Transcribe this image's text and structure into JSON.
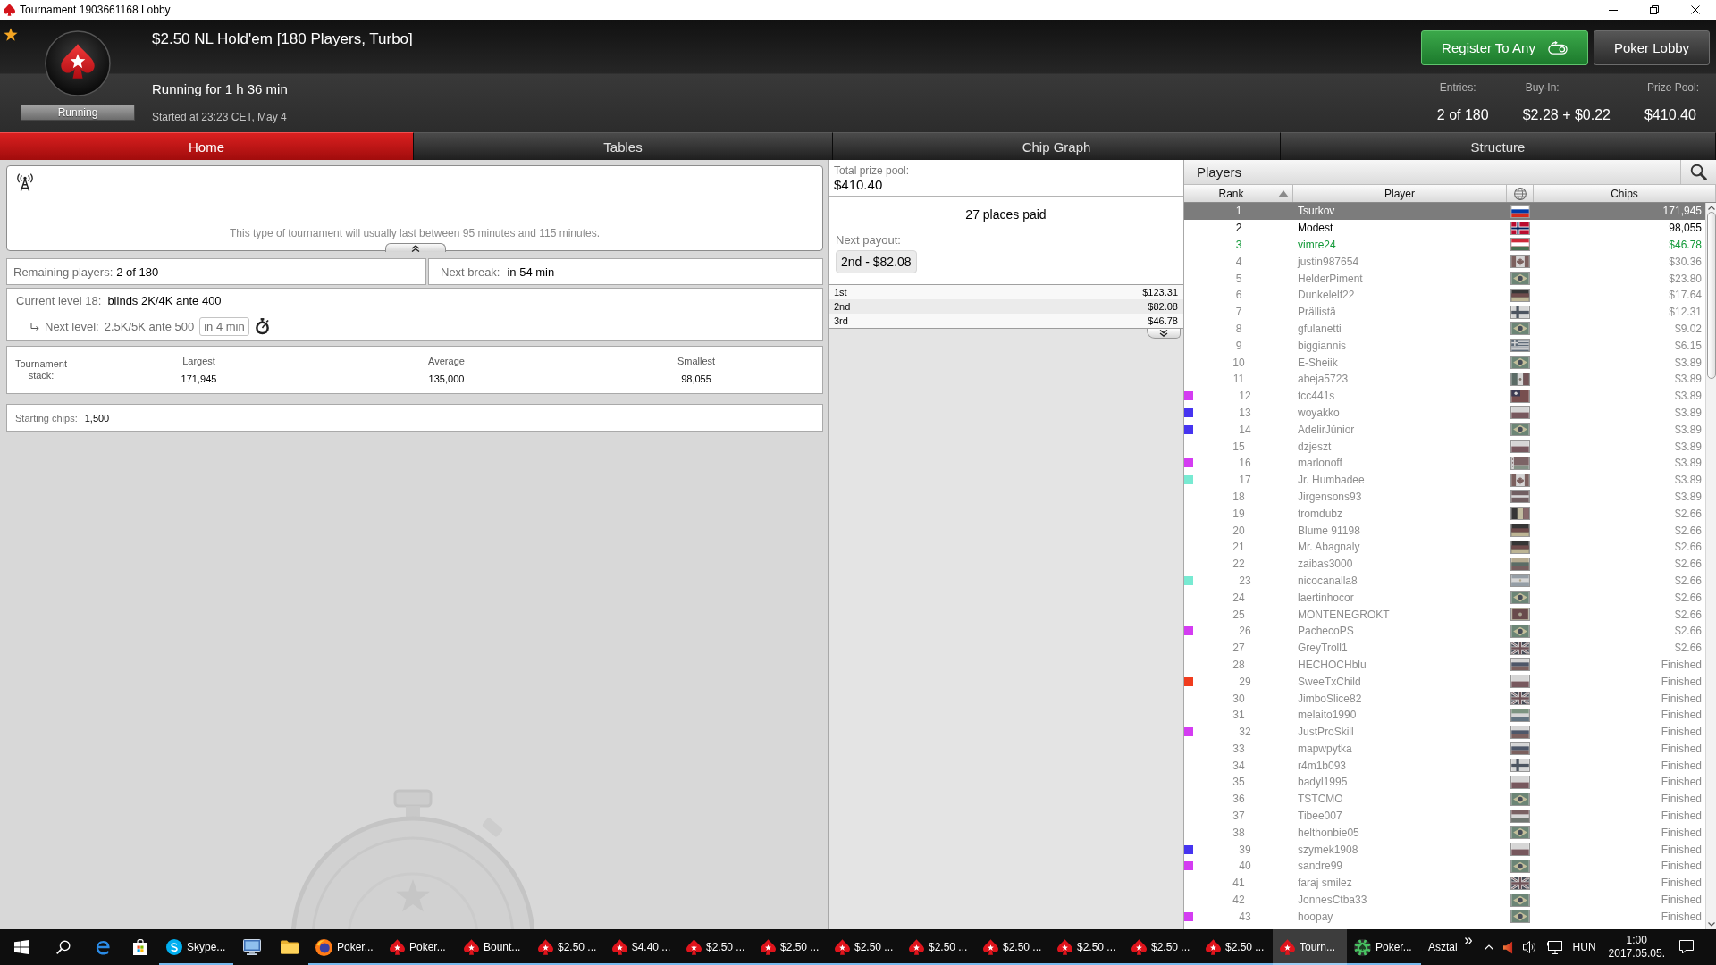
{
  "window": {
    "title": "Tournament 1903661168 Lobby"
  },
  "header": {
    "title": "$2.50 NL Hold'em [180 Players, Turbo]",
    "status": "Running",
    "running_for": "Running for 1 h 36 min",
    "started": "Started at 23:23 CET, May 4",
    "buttons": [
      {
        "label": "Register To Any",
        "kind": "primary"
      },
      {
        "label": "Poker Lobby",
        "kind": "secondary"
      }
    ],
    "stats": [
      {
        "label": "Entries:",
        "value": "2 of 180"
      },
      {
        "label": "Buy-In:",
        "value": "$2.28 + $0.22"
      },
      {
        "label": "Prize Pool:",
        "value": "$410.40"
      }
    ]
  },
  "tabs": [
    {
      "label": "Home",
      "selected": true
    },
    {
      "label": "Tables",
      "selected": false
    },
    {
      "label": "Chip Graph",
      "selected": false
    },
    {
      "label": "Structure",
      "selected": false
    }
  ],
  "info": {
    "note": "This type of tournament will usually last between 95 minutes and 115 minutes."
  },
  "summary": {
    "remaining": {
      "label": "Remaining players:",
      "value": "2 of 180"
    },
    "next_break": {
      "label": "Next break:",
      "value": "in 54 min"
    }
  },
  "level": {
    "current_label": "Current level 18:",
    "current": "blinds 2K/4K ante 400",
    "next_label": "Next level:",
    "next": "2.5K/5K ante 500",
    "next_in": "in 4 min"
  },
  "stack": {
    "label": "Tournament stack:",
    "columns": [
      {
        "label": "Largest",
        "value": "171,945"
      },
      {
        "label": "Average",
        "value": "135,000"
      },
      {
        "label": "Smallest",
        "value": "98,055"
      }
    ]
  },
  "starting_chips": {
    "label": "Starting chips:",
    "value": "1,500"
  },
  "prizes": {
    "total_label": "Total prize pool:",
    "total": "$410.40",
    "places_paid": "27 places paid",
    "next_payout_label": "Next payout:",
    "next_payout": "2nd - $82.08",
    "payouts": [
      {
        "place": "1st",
        "amount": "$123.31"
      },
      {
        "place": "2nd",
        "amount": "$82.08"
      },
      {
        "place": "3rd",
        "amount": "$46.78"
      }
    ]
  },
  "players": {
    "title": "Players",
    "columns": [
      {
        "kind": "text",
        "label": "Rank",
        "sorted": true
      },
      {
        "kind": "text",
        "label": "Player",
        "sorted": false
      },
      {
        "kind": "icon",
        "sorted": false
      },
      {
        "kind": "text",
        "label": "Chips",
        "sorted": false
      }
    ],
    "rows": [
      {
        "rank": "1",
        "player": "Tsurkov",
        "flag": {
          "kind": "russia"
        },
        "chips": "171,945",
        "kind": "playing",
        "selected": true
      },
      {
        "rank": "2",
        "player": "Modest",
        "flag": {
          "kind": "norway"
        },
        "chips": "98,055",
        "kind": "playing",
        "selected": false
      },
      {
        "rank": "3",
        "player": "vimre24",
        "flag": {
          "kind": "hungary"
        },
        "chips": "$46.78",
        "kind": "self",
        "selected": false
      },
      {
        "rank": "4",
        "player": "justin987654",
        "flag": {
          "kind": "canada"
        },
        "chips": "$30.36",
        "kind": "out",
        "selected": false
      },
      {
        "rank": "5",
        "player": "HelderPiment",
        "flag": {
          "kind": "brazil"
        },
        "chips": "$23.80",
        "kind": "out",
        "selected": false
      },
      {
        "rank": "6",
        "player": "Dunkelelf22",
        "flag": {
          "kind": "germany"
        },
        "chips": "$17.64",
        "kind": "out",
        "selected": false
      },
      {
        "rank": "7",
        "player": "Prällistä",
        "flag": {
          "kind": "finland"
        },
        "chips": "$12.31",
        "kind": "out",
        "selected": false
      },
      {
        "rank": "8",
        "player": "gfulanetti",
        "flag": {
          "kind": "brazil"
        },
        "chips": "$9.02",
        "kind": "out",
        "selected": false
      },
      {
        "rank": "9",
        "player": "biggiannis",
        "flag": {
          "kind": "greece"
        },
        "chips": "$6.15",
        "kind": "out",
        "selected": false
      },
      {
        "rank": "10",
        "player": "E-Sheiik",
        "flag": {
          "kind": "brazil"
        },
        "chips": "$3.89",
        "kind": "out",
        "selected": false
      },
      {
        "rank": "11",
        "player": "abeja5723",
        "flag": {
          "kind": "mexico"
        },
        "chips": "$3.89",
        "kind": "out",
        "selected": false
      },
      {
        "rank": "12",
        "player": "tcc441s",
        "flag": {
          "kind": "taiwan"
        },
        "chips": "$3.89",
        "kind": "out",
        "selected": false,
        "color": "#d43cf2"
      },
      {
        "rank": "13",
        "player": "woyakko",
        "flag": {
          "kind": "poland"
        },
        "chips": "$3.89",
        "kind": "out",
        "selected": false,
        "color": "#4634f0"
      },
      {
        "rank": "14",
        "player": "AdelirJúnior",
        "flag": {
          "kind": "brazil"
        },
        "chips": "$3.89",
        "kind": "out",
        "selected": false,
        "color": "#4634f0"
      },
      {
        "rank": "15",
        "player": "dzjeszt",
        "flag": {
          "kind": "poland"
        },
        "chips": "$3.89",
        "kind": "out",
        "selected": false
      },
      {
        "rank": "16",
        "player": "marlonoff",
        "flag": {
          "kind": "belarus"
        },
        "chips": "$3.89",
        "kind": "out",
        "selected": false,
        "color": "#d43cf2"
      },
      {
        "rank": "17",
        "player": "Jr. Humbadee",
        "flag": {
          "kind": "canada"
        },
        "chips": "$3.89",
        "kind": "out",
        "selected": false,
        "color": "#78ead2"
      },
      {
        "rank": "18",
        "player": "Jirgensons93",
        "flag": {
          "kind": "latvia"
        },
        "chips": "$3.89",
        "kind": "out",
        "selected": false
      },
      {
        "rank": "19",
        "player": "tromdubz",
        "flag": {
          "kind": "belgium"
        },
        "chips": "$2.66",
        "kind": "out",
        "selected": false
      },
      {
        "rank": "20",
        "player": "Blume 91198",
        "flag": {
          "kind": "germany"
        },
        "chips": "$2.66",
        "kind": "out",
        "selected": false
      },
      {
        "rank": "21",
        "player": "Mr. Abagnaly",
        "flag": {
          "kind": "germany"
        },
        "chips": "$2.66",
        "kind": "out",
        "selected": false
      },
      {
        "rank": "22",
        "player": "zaibas3000",
        "flag": {
          "kind": "lithuania"
        },
        "chips": "$2.66",
        "kind": "out",
        "selected": false
      },
      {
        "rank": "23",
        "player": "nicocanalla8",
        "flag": {
          "kind": "argentina"
        },
        "chips": "$2.66",
        "kind": "out",
        "selected": false,
        "color": "#78ead2"
      },
      {
        "rank": "24",
        "player": "laertinhocor",
        "flag": {
          "kind": "brazil"
        },
        "chips": "$2.66",
        "kind": "out",
        "selected": false
      },
      {
        "rank": "25",
        "player": "MONTENEGROKT",
        "flag": {
          "kind": "montenegro"
        },
        "chips": "$2.66",
        "kind": "out",
        "selected": false
      },
      {
        "rank": "26",
        "player": "PachecoPS",
        "flag": {
          "kind": "brazil"
        },
        "chips": "$2.66",
        "kind": "out",
        "selected": false,
        "color": "#d43cf2"
      },
      {
        "rank": "27",
        "player": "GreyTroll1",
        "flag": {
          "kind": "uk"
        },
        "chips": "$2.66",
        "kind": "out",
        "selected": false
      },
      {
        "rank": "28",
        "player": "HECHOCHblu",
        "flag": {
          "kind": "russia"
        },
        "chips": "Finished",
        "kind": "out",
        "selected": false
      },
      {
        "rank": "29",
        "player": "SweeTxChild",
        "flag": {
          "kind": "poland"
        },
        "chips": "Finished",
        "kind": "out",
        "selected": false,
        "color": "#f03c1e"
      },
      {
        "rank": "30",
        "player": "JimboSlice82",
        "flag": {
          "kind": "uk"
        },
        "chips": "Finished",
        "kind": "out",
        "selected": false
      },
      {
        "rank": "31",
        "player": "melaito1990",
        "flag": {
          "kind": "sierraleone"
        },
        "chips": "Finished",
        "kind": "out",
        "selected": false
      },
      {
        "rank": "32",
        "player": "JustProSkill",
        "flag": {
          "kind": "russia"
        },
        "chips": "Finished",
        "kind": "out",
        "selected": false,
        "color": "#d43cf2"
      },
      {
        "rank": "33",
        "player": "mapwpytka",
        "flag": {
          "kind": "russia"
        },
        "chips": "Finished",
        "kind": "out",
        "selected": false
      },
      {
        "rank": "34",
        "player": "r4m1b093",
        "flag": {
          "kind": "finland"
        },
        "chips": "Finished",
        "kind": "out",
        "selected": false
      },
      {
        "rank": "35",
        "player": "badyl1995",
        "flag": {
          "kind": "poland"
        },
        "chips": "Finished",
        "kind": "out",
        "selected": false
      },
      {
        "rank": "36",
        "player": "TSTCMO",
        "flag": {
          "kind": "brazil"
        },
        "chips": "Finished",
        "kind": "out",
        "selected": false
      },
      {
        "rank": "37",
        "player": "Tibee007",
        "flag": {
          "kind": "hungary"
        },
        "chips": "Finished",
        "kind": "out",
        "selected": false
      },
      {
        "rank": "38",
        "player": "helthonbie05",
        "flag": {
          "kind": "brazil"
        },
        "chips": "Finished",
        "kind": "out",
        "selected": false
      },
      {
        "rank": "39",
        "player": "szymek1908",
        "flag": {
          "kind": "poland"
        },
        "chips": "Finished",
        "kind": "out",
        "selected": false,
        "color": "#4634f0"
      },
      {
        "rank": "40",
        "player": "sandre99",
        "flag": {
          "kind": "brazil"
        },
        "chips": "Finished",
        "kind": "out",
        "selected": false,
        "color": "#d43cf2"
      },
      {
        "rank": "41",
        "player": "faraj smilez",
        "flag": {
          "kind": "uk"
        },
        "chips": "Finished",
        "kind": "out",
        "selected": false
      },
      {
        "rank": "42",
        "player": "JonnesCtba33",
        "flag": {
          "kind": "brazil"
        },
        "chips": "Finished",
        "kind": "out",
        "selected": false
      },
      {
        "rank": "43",
        "player": "hoopay",
        "flag": {
          "kind": "brazil"
        },
        "chips": "Finished",
        "kind": "out",
        "selected": false,
        "color": "#d43cf2"
      }
    ]
  },
  "taskbar": {
    "items": [
      {
        "kind": "edge",
        "selected": false
      },
      {
        "kind": "store",
        "selected": false
      },
      {
        "kind": "skype",
        "label": "Skype...",
        "selected": false,
        "running": true
      },
      {
        "kind": "monitor",
        "selected": false
      },
      {
        "kind": "folder",
        "selected": false
      },
      {
        "kind": "firefox",
        "label": "Poker...",
        "selected": false,
        "running": true
      },
      {
        "kind": "spade",
        "label": "Poker...",
        "selected": false,
        "running": true
      },
      {
        "kind": "spade",
        "label": "Bount...",
        "selected": false,
        "running": true
      },
      {
        "kind": "spade",
        "label": "$2.50 ...",
        "selected": false,
        "running": true
      },
      {
        "kind": "spade",
        "label": "$4.40 ...",
        "selected": false,
        "running": true
      },
      {
        "kind": "spade",
        "label": "$2.50 ...",
        "selected": false,
        "running": true
      },
      {
        "kind": "spade",
        "label": "$2.50 ...",
        "selected": false,
        "running": true
      },
      {
        "kind": "spade",
        "label": "$2.50 ...",
        "selected": false,
        "running": true
      },
      {
        "kind": "spade",
        "label": "$2.50 ...",
        "selected": false,
        "running": true
      },
      {
        "kind": "spade",
        "label": "$2.50 ...",
        "selected": false,
        "running": true
      },
      {
        "kind": "spade",
        "label": "$2.50 ...",
        "selected": false,
        "running": true
      },
      {
        "kind": "spade",
        "label": "$2.50 ...",
        "selected": false,
        "running": true
      },
      {
        "kind": "spade",
        "label": "$2.50 ...",
        "selected": false,
        "running": true
      },
      {
        "kind": "spade",
        "label": "Tourn...",
        "selected": true,
        "running": true
      },
      {
        "kind": "chip",
        "label": "Poker...",
        "selected": false,
        "running": true
      }
    ],
    "toolbar_label": "Asztal",
    "language": "HUN",
    "time": "1:00",
    "date": "2017.05.05."
  }
}
